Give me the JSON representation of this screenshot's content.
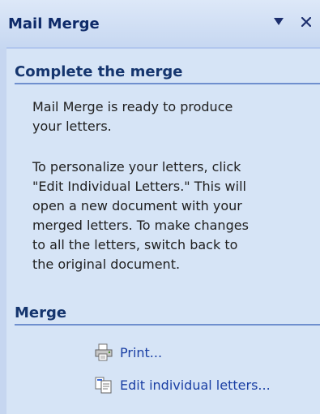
{
  "pane": {
    "title": "Mail Merge",
    "controls": {
      "dropdown_icon": "triangle-down-icon",
      "close_icon": "close-icon"
    }
  },
  "sections": {
    "complete": {
      "heading": "Complete the merge",
      "para1_lines": [
        "Mail Merge is ready to produce",
        "your letters."
      ],
      "para2_lines": [
        "To personalize your letters, click",
        "\"Edit Individual Letters.\" This will",
        "open a new document with your",
        "merged letters. To make changes",
        "to all the letters, switch back to",
        "the original document."
      ]
    },
    "merge": {
      "heading": "Merge",
      "items": [
        {
          "label": "Print...",
          "icon": "printer-icon"
        },
        {
          "label": "Edit individual letters...",
          "icon": "document-edit-icon"
        }
      ]
    }
  },
  "colors": {
    "pane_background": "#d6e4f6",
    "heading_text": "#15356e",
    "link_text": "#1a3fa4",
    "rule": "#6f8fce"
  }
}
